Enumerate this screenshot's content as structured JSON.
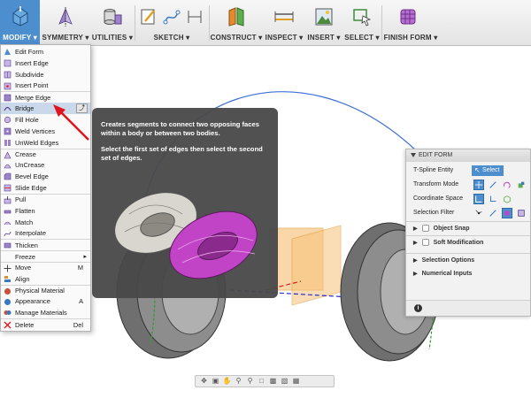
{
  "toolbar": {
    "groups": [
      {
        "label": "MODIFY"
      },
      {
        "label": "SYMMETRY"
      },
      {
        "label": "UTILITIES"
      },
      {
        "label": "SKETCH"
      },
      {
        "label": "CONSTRUCT"
      },
      {
        "label": "INSPECT"
      },
      {
        "label": "INSERT"
      },
      {
        "label": "SELECT"
      },
      {
        "label": "FINISH FORM"
      }
    ]
  },
  "menu": {
    "items": [
      {
        "label": "Edit Form"
      },
      {
        "label": "Insert Edge"
      },
      {
        "label": "Subdivide"
      },
      {
        "label": "Insert Point"
      },
      {
        "label": "Merge Edge"
      },
      {
        "label": "Bridge"
      },
      {
        "label": "Fill Hole"
      },
      {
        "label": "Weld Vertices"
      },
      {
        "label": "UnWeld Edges"
      },
      {
        "label": "Crease"
      },
      {
        "label": "UnCrease"
      },
      {
        "label": "Bevel Edge"
      },
      {
        "label": "Slide Edge"
      },
      {
        "label": "Pull"
      },
      {
        "label": "Flatten"
      },
      {
        "label": "Match"
      },
      {
        "label": "Interpolate"
      },
      {
        "label": "Thicken"
      },
      {
        "label": "Freeze"
      },
      {
        "label": "Move",
        "shortcut": "M"
      },
      {
        "label": "Align"
      },
      {
        "label": "Physical Material"
      },
      {
        "label": "Appearance",
        "shortcut": "A"
      },
      {
        "label": "Manage Materials"
      },
      {
        "label": "Delete",
        "shortcut": "Del"
      }
    ]
  },
  "tooltip": {
    "line1": "Creates segments to connect two opposing faces within a body or between two bodies.",
    "line2": "Select the first set of edges then select the second set of edges."
  },
  "edit_form": {
    "title": "EDIT FORM",
    "tspline_label": "T-Spline Entity",
    "select_label": "Select",
    "transform_label": "Transform Mode",
    "coord_label": "Coordinate Space",
    "filter_label": "Selection Filter",
    "object_snap": "Object Snap",
    "soft_mod": "Soft Modification",
    "selection_options": "Selection Options",
    "numerical_inputs": "Numerical Inputs"
  },
  "colors": {
    "accent": "#4d8ecf",
    "tooltip_bg": "#484848",
    "arrow": "#e0141e"
  }
}
